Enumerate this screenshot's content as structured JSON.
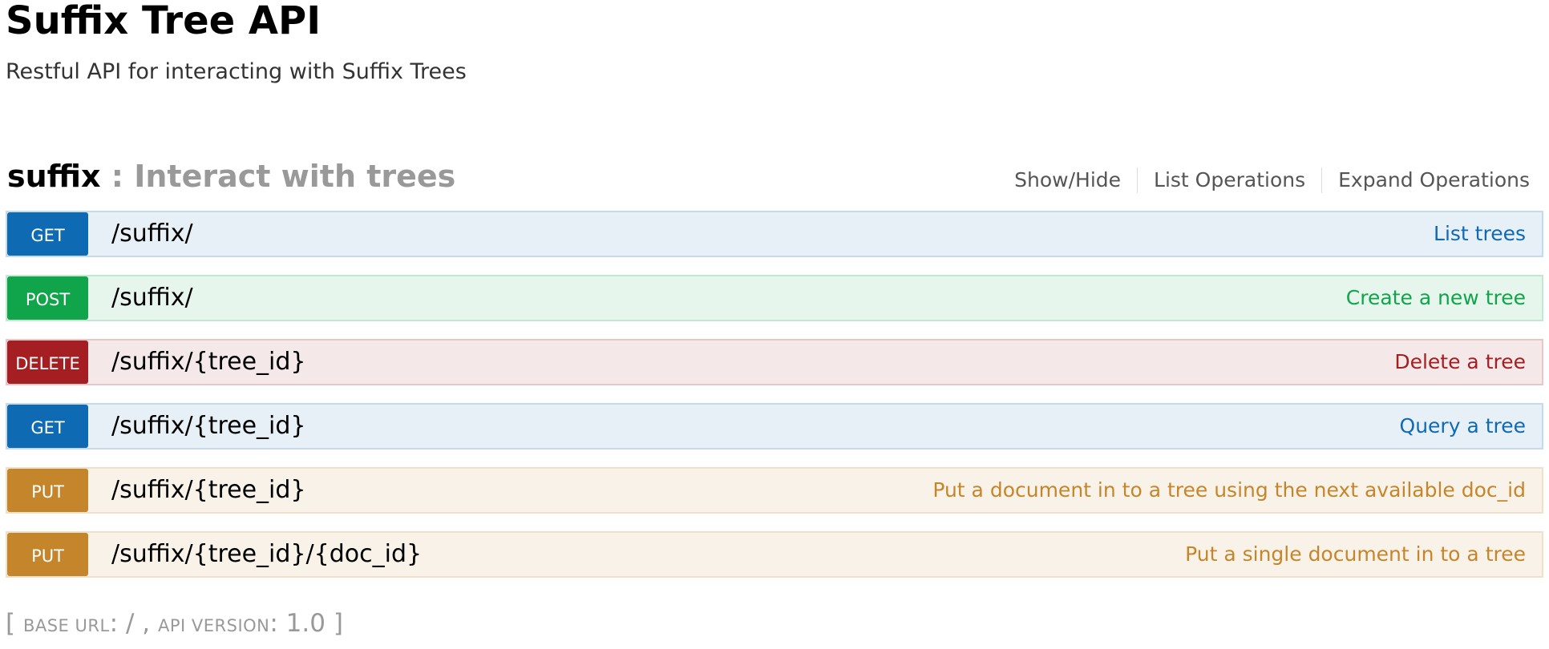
{
  "api": {
    "title": "Suffix Tree API",
    "description": "Restful API for interacting with Suffix Trees"
  },
  "resource": {
    "name": "suffix",
    "separator": " : ",
    "description": "Interact with trees",
    "actions": [
      "Show/Hide",
      "List Operations",
      "Expand Operations"
    ]
  },
  "operations": [
    {
      "method": "GET",
      "path": "/suffix/",
      "summary": "List trees"
    },
    {
      "method": "POST",
      "path": "/suffix/",
      "summary": "Create a new tree"
    },
    {
      "method": "DELETE",
      "path": "/suffix/{tree_id}",
      "summary": "Delete a tree"
    },
    {
      "method": "GET",
      "path": "/suffix/{tree_id}",
      "summary": "Query a tree"
    },
    {
      "method": "PUT",
      "path": "/suffix/{tree_id}",
      "summary": "Put a document in to a tree using the next available doc_id"
    },
    {
      "method": "PUT",
      "path": "/suffix/{tree_id}/{doc_id}",
      "summary": "Put a single document in to a tree"
    }
  ],
  "footer": {
    "open_bracket": "[ ",
    "base_url_label": "BASE URL",
    "base_url_value": ": / , ",
    "api_version_label": "API VERSION",
    "api_version_value": ": 1.0",
    "close_bracket": " ]"
  },
  "colors": {
    "get": "#0f6ab4",
    "post": "#10a54a",
    "delete": "#a41e22",
    "put": "#c5862b"
  }
}
